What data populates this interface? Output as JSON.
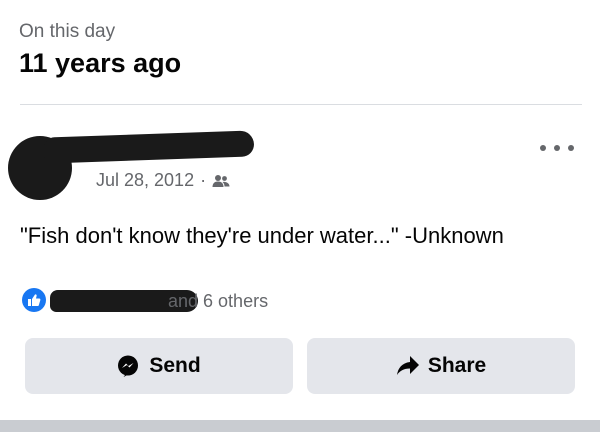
{
  "memory": {
    "label": "On this day",
    "years_ago": "11 years ago"
  },
  "post": {
    "date": "Jul 28, 2012",
    "separator": "·",
    "audience_icon": "friends-icon",
    "text": "\"Fish don't know they're under water...\" -Unknown",
    "reactions": {
      "icon": "like-icon",
      "others_text": "and 6 others"
    }
  },
  "actions": {
    "send_label": "Send",
    "send_icon": "messenger-icon",
    "share_label": "Share",
    "share_icon": "share-arrow-icon"
  },
  "colors": {
    "accent_blue": "#1877f2",
    "secondary_text": "#65676b",
    "button_bg": "#e4e6eb"
  }
}
